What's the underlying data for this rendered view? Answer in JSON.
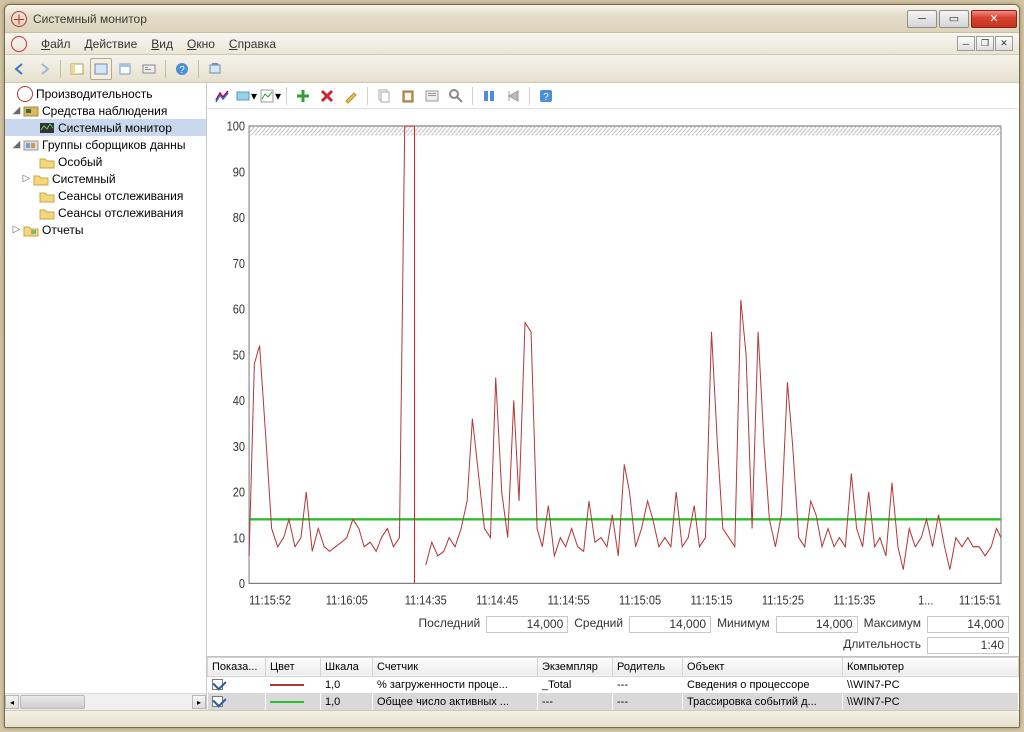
{
  "window": {
    "title": "Системный монитор"
  },
  "menubar": {
    "file": "Файл",
    "action": "Действие",
    "view": "Вид",
    "window": "Окно",
    "help": "Справка"
  },
  "tree": {
    "root": "Производительность",
    "monitoring": "Средства наблюдения",
    "system_monitor": "Системный монитор",
    "collectors": "Группы сборщиков данны",
    "custom": "Особый",
    "system": "Системный",
    "sessions1": "Сеансы отслеживания",
    "sessions2": "Сеансы отслеживания",
    "reports": "Отчеты"
  },
  "stats": {
    "last_label": "Последний",
    "last_val": "14,000",
    "avg_label": "Средний",
    "avg_val": "14,000",
    "min_label": "Минимум",
    "min_val": "14,000",
    "max_label": "Максимум",
    "max_val": "14,000",
    "dur_label": "Длительность",
    "dur_val": "1:40"
  },
  "table": {
    "headers": {
      "show": "Показа...",
      "color": "Цвет",
      "scale": "Шкала",
      "counter": "Счетчик",
      "instance": "Экземпляр",
      "parent": "Родитель",
      "object": "Объект",
      "computer": "Компьютер"
    },
    "rows": [
      {
        "color": "#b33838",
        "scale": "1,0",
        "counter": "% загруженности проце...",
        "instance": "_Total",
        "parent": "---",
        "object": "Сведения о процессоре",
        "computer": "\\\\WIN7-PC"
      },
      {
        "color": "#2bbf2b",
        "scale": "1,0",
        "counter": "Общее число активных ...",
        "instance": "---",
        "parent": "---",
        "object": "Трассировка событий д...",
        "computer": "\\\\WIN7-PC"
      }
    ]
  },
  "chart_data": {
    "type": "line",
    "ylim": [
      0,
      100
    ],
    "yticks": [
      0,
      10,
      20,
      30,
      40,
      50,
      60,
      70,
      80,
      90,
      100
    ],
    "xticks": [
      "11:15:52",
      "11:16:05",
      "11:14:35",
      "11:14:45",
      "11:14:55",
      "11:15:05",
      "11:15:15",
      "11:15:25",
      "11:15:35",
      "1...",
      "11:15:51"
    ],
    "xtick_pos": [
      0,
      0.13,
      0.235,
      0.33,
      0.425,
      0.52,
      0.615,
      0.71,
      0.805,
      0.9,
      1.0
    ],
    "cursor_x": 0.22,
    "avg_line": 14,
    "series": [
      {
        "name": "% загруженности процессора",
        "color": "#b33838",
        "x": [
          0,
          0.007,
          0.014,
          0.023,
          0.03,
          0.038,
          0.046,
          0.053,
          0.061,
          0.069,
          0.076,
          0.084,
          0.092,
          0.1,
          0.107,
          0.115,
          0.123,
          0.13,
          0.138,
          0.146,
          0.153,
          0.161,
          0.169,
          0.176,
          0.184,
          0.192,
          0.2,
          0.207,
          0.215,
          0.22,
          0.235,
          0.243,
          0.251,
          0.259,
          0.266,
          0.274,
          0.282,
          0.29,
          0.297,
          0.305,
          0.313,
          0.321,
          0.328,
          0.336,
          0.344,
          0.352,
          0.359,
          0.367,
          0.375,
          0.383,
          0.39,
          0.398,
          0.406,
          0.414,
          0.421,
          0.429,
          0.437,
          0.445,
          0.452,
          0.46,
          0.468,
          0.476,
          0.483,
          0.491,
          0.499,
          0.506,
          0.514,
          0.522,
          0.53,
          0.537,
          0.545,
          0.553,
          0.561,
          0.568,
          0.576,
          0.584,
          0.592,
          0.599,
          0.607,
          0.615,
          0.623,
          0.63,
          0.638,
          0.646,
          0.654,
          0.661,
          0.669,
          0.677,
          0.685,
          0.692,
          0.7,
          0.708,
          0.716,
          0.723,
          0.731,
          0.739,
          0.747,
          0.754,
          0.762,
          0.77,
          0.778,
          0.785,
          0.793,
          0.801,
          0.808,
          0.816,
          0.824,
          0.832,
          0.839,
          0.847,
          0.855,
          0.863,
          0.87,
          0.878,
          0.886,
          0.894,
          0.901,
          0.909,
          0.917,
          0.925,
          0.932,
          0.94,
          0.948,
          0.956,
          0.963,
          0.971,
          0.979,
          0.987,
          0.994,
          1.0
        ],
        "y": [
          6,
          48,
          52,
          30,
          12,
          8,
          10,
          14,
          8,
          10,
          20,
          7,
          12,
          8,
          7,
          8,
          9,
          10,
          14,
          12,
          8,
          9,
          7,
          10,
          12,
          8,
          10,
          100,
          100,
          100,
          4,
          9,
          6,
          7,
          10,
          8,
          12,
          18,
          36,
          24,
          12,
          10,
          45,
          20,
          10,
          40,
          18,
          57,
          55,
          12,
          8,
          17,
          6,
          10,
          8,
          12,
          8,
          7,
          18,
          9,
          10,
          8,
          15,
          6,
          26,
          20,
          8,
          12,
          18,
          14,
          8,
          10,
          8,
          20,
          8,
          10,
          17,
          8,
          10,
          55,
          30,
          12,
          10,
          8,
          62,
          50,
          12,
          55,
          30,
          14,
          8,
          15,
          44,
          30,
          10,
          8,
          18,
          15,
          8,
          12,
          8,
          10,
          8,
          24,
          12,
          8,
          20,
          8,
          10,
          6,
          22,
          8,
          3,
          12,
          8,
          10,
          14,
          8,
          15,
          8,
          3,
          10,
          8,
          10,
          8,
          8,
          6,
          8,
          12,
          10
        ]
      }
    ]
  }
}
